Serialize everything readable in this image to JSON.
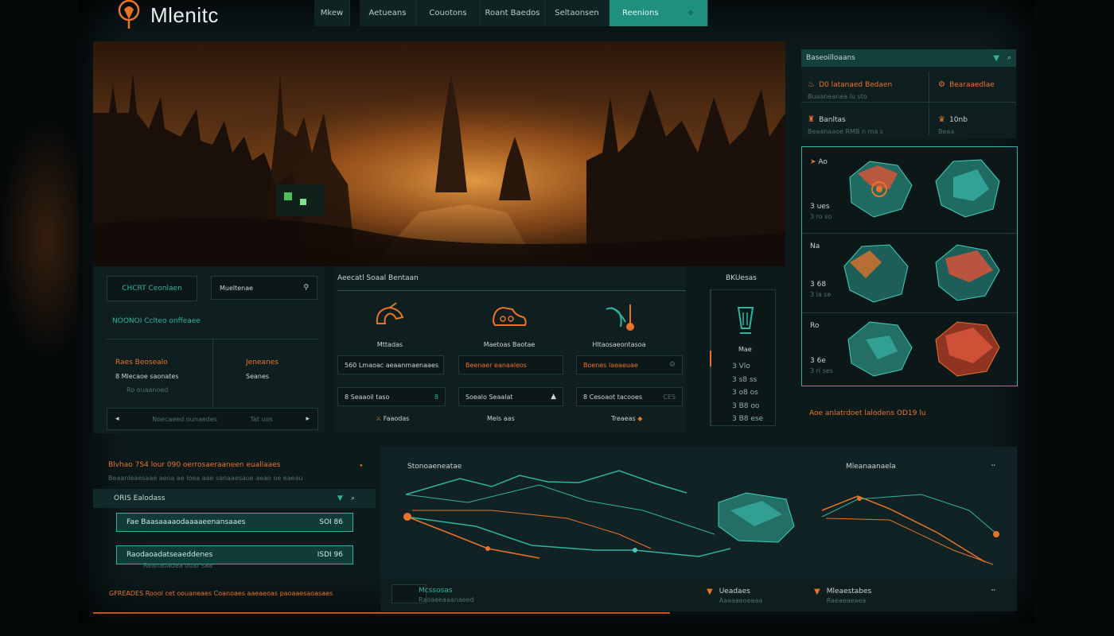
{
  "header": {
    "brand": "Mlenitc",
    "nav": [
      {
        "label": "Mkew"
      },
      {
        "label": "Aetueans"
      },
      {
        "label": "Couotons"
      },
      {
        "label": "Roant Baedos"
      },
      {
        "label": "Seltaonsen"
      },
      {
        "label": "Reenions"
      }
    ]
  },
  "top_right": {
    "title": "Baseoilloaans",
    "stats": [
      {
        "icon": "flame-icon",
        "label": "D0 latanaed Bedaen",
        "sub": "Buaaneanea lu sto"
      },
      {
        "icon": "gear-icon",
        "label": "Bearaaedlae",
        "sub": ""
      },
      {
        "icon": "trophy-icon",
        "label": "Banltas",
        "sub": "Beaanaaoe RMB n ma s"
      },
      {
        "icon": "cup-icon",
        "label": "10nb",
        "sub": "Beaa"
      }
    ]
  },
  "maps": [
    {
      "title": "Ao",
      "sub": "3 ues",
      "note": "3 ro so"
    },
    {
      "title": "Na",
      "sub": "3 68",
      "note": "3 la se"
    },
    {
      "title": "Ro",
      "sub": "3 6e",
      "note": "3 ri ses"
    }
  ],
  "maps_footer": "Aoe anlatrdoet lalodens OD19 lu",
  "left_panel": {
    "button_1": "CHCRT Ceonlaen",
    "button_2": "Mueltenae",
    "headline": "NOONOI Cclteo onffeaee",
    "col1_title": "Raes Beosealo",
    "col1_line": "8 Mlecaoe saonates",
    "col1_sub": "Ro ouaanoed",
    "col2_title": "Jeneanes",
    "col2_line": "Seanes",
    "footer_left": "Noecaeed ounaedes",
    "footer_mid": "Tat uos"
  },
  "center_panel": {
    "title": "Aeecatl Soaal Bentaan",
    "items": [
      {
        "label": "Mttadas",
        "icon": "axe-icon"
      },
      {
        "label": "Maetoas Baotae",
        "icon": "boot-icon"
      },
      {
        "label": "Hltaosaeontasoa",
        "icon": "claw-icon"
      }
    ],
    "row1": [
      {
        "label": "560 Lmaoac aeaanmaenaaes"
      },
      {
        "label": "Beenaer eanaaleos",
        "accent": "orange"
      },
      {
        "label": "Boenes laeaeuae",
        "accent": "orange"
      }
    ],
    "row2": [
      {
        "label": "8 Seaaoil taso"
      },
      {
        "label": "Soealo Seaalat"
      },
      {
        "label": "8 Cesoaot tacooes"
      }
    ],
    "row2_tags": [
      "8",
      "",
      "CES"
    ],
    "row3": [
      "Faaodas",
      "Mels aas",
      "Treaeas"
    ]
  },
  "mini_panel": {
    "title": "BKUesas",
    "label": "Mae",
    "values": [
      "3 Vlo",
      "3 s8 ss",
      "3 o8 os",
      "3 B8 oo",
      "3 B8 ese"
    ]
  },
  "bottom_left": {
    "title": "Blvhao 7S4 lour 090 oerrosaeraaneen euallaaes",
    "subtitle": "Beaanleaesaae aeoa ae loea aae sanaaesaoe aeao oe eaeau",
    "filter": "ORIS Ealodass",
    "rows": [
      {
        "label": "Fae Baasaaaaodaaaaeenansaaes",
        "sub": "",
        "value": "SOI 86"
      },
      {
        "label": "Raodaoadatseaeddenes",
        "sub": "Reanaoadea ouar saa",
        "value": "ISDI 96"
      }
    ],
    "footer": "GFREADES Roool cet oouaneaes Coanoaes aaeaeoas paoaaesaoasaes"
  },
  "bottom_center": {
    "label_left": "Stonoaeneatae",
    "label_right": "Mleanaanaela",
    "footer_items": [
      {
        "label": "Mcssosas",
        "sub": "Raoaeeaaanaeed"
      },
      {
        "label": "Ueadaes",
        "sub": "Aaeaaeoeaaa"
      },
      {
        "label": "Mleaestabes",
        "sub": "Raeaeaeaea"
      }
    ]
  },
  "colors": {
    "teal": "#2fb3a0",
    "orange": "#e8742a",
    "background": "#0d1a1b"
  }
}
